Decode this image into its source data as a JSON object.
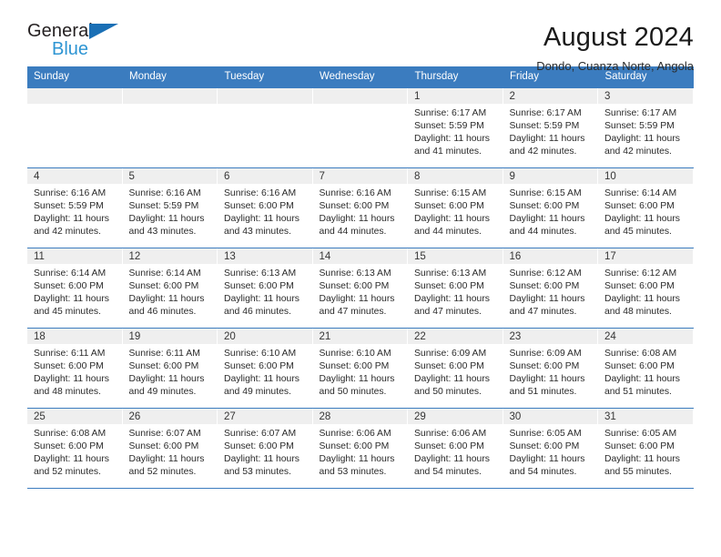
{
  "brand": {
    "name_part1": "General",
    "name_part2": "Blue",
    "triangle_color": "#1a6fb5",
    "blue_text_color": "#2e95d3"
  },
  "header": {
    "title": "August 2024",
    "subtitle": "Dondo, Cuanza Norte, Angola"
  },
  "theme": {
    "header_blue": "#3b7cbf",
    "daynum_band": "#efefef"
  },
  "weekdays": [
    "Sunday",
    "Monday",
    "Tuesday",
    "Wednesday",
    "Thursday",
    "Friday",
    "Saturday"
  ],
  "weeks": [
    [
      {
        "day": "",
        "empty": true
      },
      {
        "day": "",
        "empty": true
      },
      {
        "day": "",
        "empty": true
      },
      {
        "day": "",
        "empty": true
      },
      {
        "day": "1",
        "sunrise": "Sunrise: 6:17 AM",
        "sunset": "Sunset: 5:59 PM",
        "daylight1": "Daylight: 11 hours",
        "daylight2": "and 41 minutes."
      },
      {
        "day": "2",
        "sunrise": "Sunrise: 6:17 AM",
        "sunset": "Sunset: 5:59 PM",
        "daylight1": "Daylight: 11 hours",
        "daylight2": "and 42 minutes."
      },
      {
        "day": "3",
        "sunrise": "Sunrise: 6:17 AM",
        "sunset": "Sunset: 5:59 PM",
        "daylight1": "Daylight: 11 hours",
        "daylight2": "and 42 minutes."
      }
    ],
    [
      {
        "day": "4",
        "sunrise": "Sunrise: 6:16 AM",
        "sunset": "Sunset: 5:59 PM",
        "daylight1": "Daylight: 11 hours",
        "daylight2": "and 42 minutes."
      },
      {
        "day": "5",
        "sunrise": "Sunrise: 6:16 AM",
        "sunset": "Sunset: 5:59 PM",
        "daylight1": "Daylight: 11 hours",
        "daylight2": "and 43 minutes."
      },
      {
        "day": "6",
        "sunrise": "Sunrise: 6:16 AM",
        "sunset": "Sunset: 6:00 PM",
        "daylight1": "Daylight: 11 hours",
        "daylight2": "and 43 minutes."
      },
      {
        "day": "7",
        "sunrise": "Sunrise: 6:16 AM",
        "sunset": "Sunset: 6:00 PM",
        "daylight1": "Daylight: 11 hours",
        "daylight2": "and 44 minutes."
      },
      {
        "day": "8",
        "sunrise": "Sunrise: 6:15 AM",
        "sunset": "Sunset: 6:00 PM",
        "daylight1": "Daylight: 11 hours",
        "daylight2": "and 44 minutes."
      },
      {
        "day": "9",
        "sunrise": "Sunrise: 6:15 AM",
        "sunset": "Sunset: 6:00 PM",
        "daylight1": "Daylight: 11 hours",
        "daylight2": "and 44 minutes."
      },
      {
        "day": "10",
        "sunrise": "Sunrise: 6:14 AM",
        "sunset": "Sunset: 6:00 PM",
        "daylight1": "Daylight: 11 hours",
        "daylight2": "and 45 minutes."
      }
    ],
    [
      {
        "day": "11",
        "sunrise": "Sunrise: 6:14 AM",
        "sunset": "Sunset: 6:00 PM",
        "daylight1": "Daylight: 11 hours",
        "daylight2": "and 45 minutes."
      },
      {
        "day": "12",
        "sunrise": "Sunrise: 6:14 AM",
        "sunset": "Sunset: 6:00 PM",
        "daylight1": "Daylight: 11 hours",
        "daylight2": "and 46 minutes."
      },
      {
        "day": "13",
        "sunrise": "Sunrise: 6:13 AM",
        "sunset": "Sunset: 6:00 PM",
        "daylight1": "Daylight: 11 hours",
        "daylight2": "and 46 minutes."
      },
      {
        "day": "14",
        "sunrise": "Sunrise: 6:13 AM",
        "sunset": "Sunset: 6:00 PM",
        "daylight1": "Daylight: 11 hours",
        "daylight2": "and 47 minutes."
      },
      {
        "day": "15",
        "sunrise": "Sunrise: 6:13 AM",
        "sunset": "Sunset: 6:00 PM",
        "daylight1": "Daylight: 11 hours",
        "daylight2": "and 47 minutes."
      },
      {
        "day": "16",
        "sunrise": "Sunrise: 6:12 AM",
        "sunset": "Sunset: 6:00 PM",
        "daylight1": "Daylight: 11 hours",
        "daylight2": "and 47 minutes."
      },
      {
        "day": "17",
        "sunrise": "Sunrise: 6:12 AM",
        "sunset": "Sunset: 6:00 PM",
        "daylight1": "Daylight: 11 hours",
        "daylight2": "and 48 minutes."
      }
    ],
    [
      {
        "day": "18",
        "sunrise": "Sunrise: 6:11 AM",
        "sunset": "Sunset: 6:00 PM",
        "daylight1": "Daylight: 11 hours",
        "daylight2": "and 48 minutes."
      },
      {
        "day": "19",
        "sunrise": "Sunrise: 6:11 AM",
        "sunset": "Sunset: 6:00 PM",
        "daylight1": "Daylight: 11 hours",
        "daylight2": "and 49 minutes."
      },
      {
        "day": "20",
        "sunrise": "Sunrise: 6:10 AM",
        "sunset": "Sunset: 6:00 PM",
        "daylight1": "Daylight: 11 hours",
        "daylight2": "and 49 minutes."
      },
      {
        "day": "21",
        "sunrise": "Sunrise: 6:10 AM",
        "sunset": "Sunset: 6:00 PM",
        "daylight1": "Daylight: 11 hours",
        "daylight2": "and 50 minutes."
      },
      {
        "day": "22",
        "sunrise": "Sunrise: 6:09 AM",
        "sunset": "Sunset: 6:00 PM",
        "daylight1": "Daylight: 11 hours",
        "daylight2": "and 50 minutes."
      },
      {
        "day": "23",
        "sunrise": "Sunrise: 6:09 AM",
        "sunset": "Sunset: 6:00 PM",
        "daylight1": "Daylight: 11 hours",
        "daylight2": "and 51 minutes."
      },
      {
        "day": "24",
        "sunrise": "Sunrise: 6:08 AM",
        "sunset": "Sunset: 6:00 PM",
        "daylight1": "Daylight: 11 hours",
        "daylight2": "and 51 minutes."
      }
    ],
    [
      {
        "day": "25",
        "sunrise": "Sunrise: 6:08 AM",
        "sunset": "Sunset: 6:00 PM",
        "daylight1": "Daylight: 11 hours",
        "daylight2": "and 52 minutes."
      },
      {
        "day": "26",
        "sunrise": "Sunrise: 6:07 AM",
        "sunset": "Sunset: 6:00 PM",
        "daylight1": "Daylight: 11 hours",
        "daylight2": "and 52 minutes."
      },
      {
        "day": "27",
        "sunrise": "Sunrise: 6:07 AM",
        "sunset": "Sunset: 6:00 PM",
        "daylight1": "Daylight: 11 hours",
        "daylight2": "and 53 minutes."
      },
      {
        "day": "28",
        "sunrise": "Sunrise: 6:06 AM",
        "sunset": "Sunset: 6:00 PM",
        "daylight1": "Daylight: 11 hours",
        "daylight2": "and 53 minutes."
      },
      {
        "day": "29",
        "sunrise": "Sunrise: 6:06 AM",
        "sunset": "Sunset: 6:00 PM",
        "daylight1": "Daylight: 11 hours",
        "daylight2": "and 54 minutes."
      },
      {
        "day": "30",
        "sunrise": "Sunrise: 6:05 AM",
        "sunset": "Sunset: 6:00 PM",
        "daylight1": "Daylight: 11 hours",
        "daylight2": "and 54 minutes."
      },
      {
        "day": "31",
        "sunrise": "Sunrise: 6:05 AM",
        "sunset": "Sunset: 6:00 PM",
        "daylight1": "Daylight: 11 hours",
        "daylight2": "and 55 minutes."
      }
    ]
  ]
}
